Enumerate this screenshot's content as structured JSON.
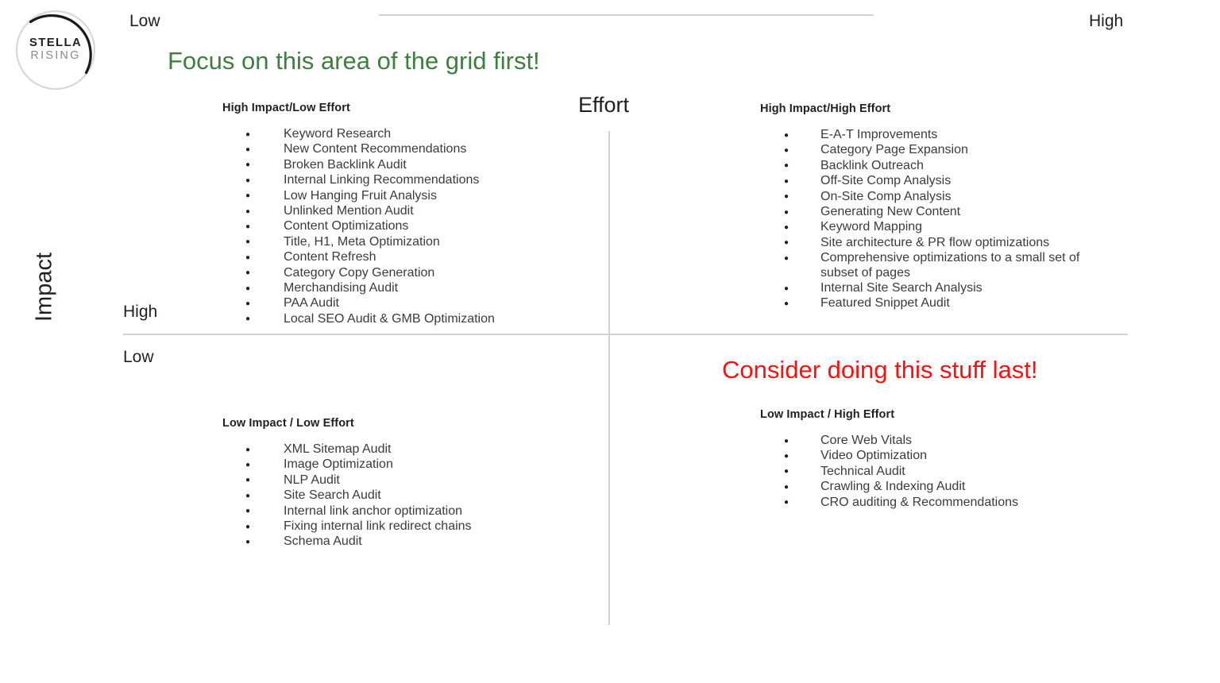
{
  "brand": {
    "logo_line1": "STELLA",
    "logo_line2": "RISING",
    "logo_icon": "stella-rising-circle-logo"
  },
  "axes": {
    "x_title": "Effort",
    "x_low": "Low",
    "x_high": "High",
    "y_title": "Impact",
    "y_high": "High",
    "y_low": "Low"
  },
  "callouts": {
    "green": "Focus on this area of the grid first!",
    "green_color": "#3f7e3e",
    "red": "Consider doing this stuff last!",
    "red_color": "#fc1111"
  },
  "quadrants": {
    "high_impact_low_effort": {
      "heading": "High Impact/Low Effort",
      "items": [
        "Keyword Research",
        "New Content Recommendations",
        "Broken Backlink Audit",
        "Internal Linking Recommendations",
        "Low Hanging Fruit Analysis",
        "Unlinked Mention Audit",
        "Content Optimizations",
        "Title, H1, Meta Optimization",
        "Content Refresh",
        "Category Copy Generation",
        "Merchandising Audit",
        "PAA Audit",
        "Local SEO Audit & GMB Optimization"
      ]
    },
    "high_impact_high_effort": {
      "heading": "High Impact/High Effort",
      "items": [
        "E-A-T Improvements",
        "Category Page Expansion",
        "Backlink Outreach",
        "Off-Site Comp Analysis",
        "On-Site Comp Analysis",
        "Generating New Content",
        "Keyword Mapping",
        "Site architecture & PR flow optimizations",
        "Comprehensive optimizations to a small set of subset of pages",
        "Internal Site Search Analysis",
        "Featured Snippet Audit"
      ]
    },
    "low_impact_low_effort": {
      "heading": "Low Impact / Low Effort",
      "items": [
        "XML Sitemap Audit",
        "Image Optimization",
        "NLP Audit",
        "Site Search Audit",
        "Internal link anchor optimization",
        "Fixing internal link redirect chains",
        "Schema Audit"
      ]
    },
    "low_impact_high_effort": {
      "heading": "Low Impact / High Effort",
      "items": [
        "Core Web Vitals",
        "Video Optimization",
        "Technical Audit",
        "Crawling & Indexing Audit",
        "CRO auditing & Recommendations"
      ]
    }
  }
}
